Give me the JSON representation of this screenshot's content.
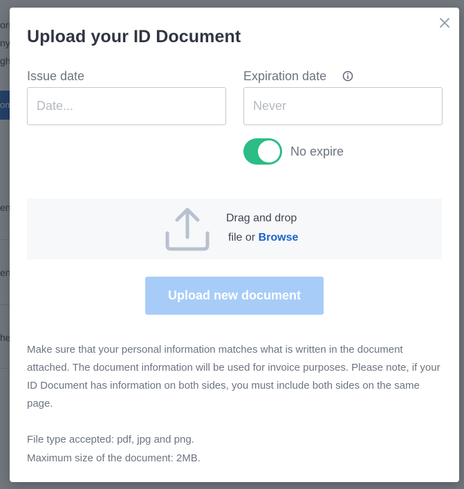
{
  "background": {
    "fragments": [
      "orm",
      "ny",
      "gh",
      "om",
      "en",
      "en",
      "he"
    ]
  },
  "modal": {
    "title": "Upload your ID Document",
    "close_icon": "close-icon",
    "issue_date": {
      "label": "Issue date",
      "value": "",
      "placeholder": "Date..."
    },
    "expiration_date": {
      "label": "Expiration date",
      "info_icon": "info-icon",
      "value": "",
      "placeholder": "Never"
    },
    "no_expire": {
      "label": "No expire",
      "enabled": true,
      "color": "#2bbd85"
    },
    "dropzone": {
      "icon": "upload-icon",
      "line1": "Drag and drop",
      "line2_prefix": "file or ",
      "browse_label": "Browse",
      "link_color": "#1d63c6"
    },
    "upload_button": {
      "label": "Upload new document",
      "color": "#a8ccf8"
    },
    "notice": "Make sure that your personal information matches what is written in the document attached. The document information will be used for invoice purposes. Please note, if your ID Document has information on both sides, you must include both sides on the same page.",
    "file_types": "File type accepted: pdf, jpg and png.",
    "max_size": "Maximum size of the document: 2MB."
  }
}
